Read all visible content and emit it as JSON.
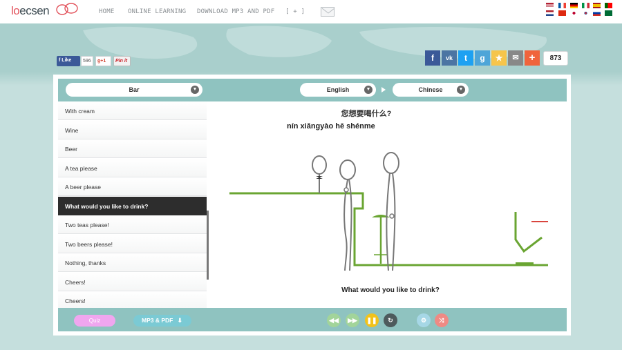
{
  "brand": {
    "logo_prefix": "lo",
    "logo_rest": "ecsen"
  },
  "nav": {
    "home": "HOME",
    "online_learning": "ONLINE LEARNING",
    "download": "DOWNLOAD MP3 AND PDF",
    "more": "[ + ]"
  },
  "social_left": {
    "like_label": "Like",
    "like_count": "596",
    "gplus_label": "+1",
    "pinit_label": "Pin it"
  },
  "share": {
    "count": "873"
  },
  "topic": {
    "selected": "Bar"
  },
  "languages": {
    "from": "English",
    "to": "Chinese"
  },
  "phrases": [
    "With cream",
    "Wine",
    "Beer",
    "A tea please",
    "A beer please",
    "What would you like to drink?",
    "Two teas please!",
    "Two beers please!",
    "Nothing, thanks",
    "Cheers!",
    "Cheers!"
  ],
  "active_index": 5,
  "lesson": {
    "chinese": "您想要喝什么?",
    "pinyin": "nín xiǎngyào hē shénme",
    "english": "What would you like to drink?"
  },
  "footer": {
    "quiz": "Quiz",
    "mp3_pdf": "MP3 & PDF"
  },
  "colors": {
    "header_band": "#8fc3c0",
    "accent_green": "#6aa532",
    "active_item": "#2d2d2d",
    "quiz_pink": "#f0a6ef",
    "mp3_blue": "#7bcad4"
  }
}
